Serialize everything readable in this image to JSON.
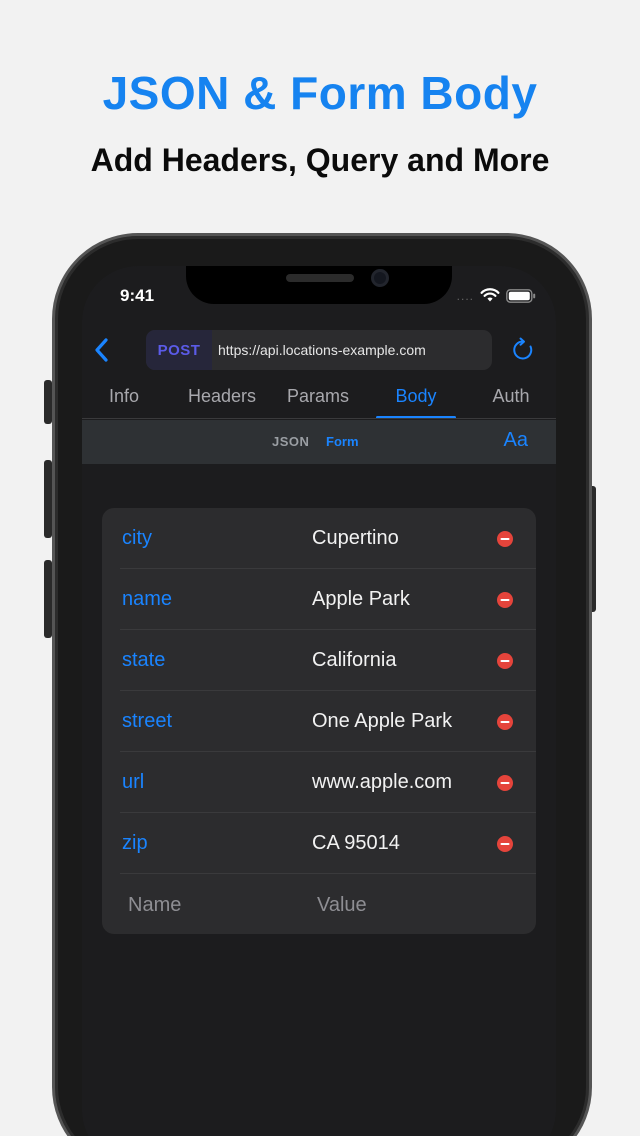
{
  "promo": {
    "headline": "JSON & Form Body",
    "subline": "Add Headers, Query and More"
  },
  "status_bar": {
    "time": "9:41",
    "signal": "....",
    "icons": [
      "wifi-icon",
      "battery-icon"
    ]
  },
  "request": {
    "method": "POST",
    "url": "https://api.locations-example.com",
    "icons": [
      "back-icon",
      "refresh-icon"
    ]
  },
  "tabs": [
    {
      "label": "Info",
      "active": false
    },
    {
      "label": "Headers",
      "active": false
    },
    {
      "label": "Params",
      "active": false
    },
    {
      "label": "Body",
      "active": true
    },
    {
      "label": "Auth",
      "active": false
    }
  ],
  "body_toolbar": {
    "json_label": "JSON",
    "form_label": "Form",
    "selected": "Form",
    "font_button": "Aa"
  },
  "form_fields": [
    {
      "key": "city",
      "value": "Cupertino"
    },
    {
      "key": "name",
      "value": "Apple Park"
    },
    {
      "key": "state",
      "value": "California"
    },
    {
      "key": "street",
      "value": "One Apple Park"
    },
    {
      "key": "url",
      "value": "www.apple.com"
    },
    {
      "key": "zip",
      "value": "CA 95014"
    }
  ],
  "new_field": {
    "name_placeholder": "Name",
    "value_placeholder": "Value"
  },
  "colors": {
    "accent": "#1a84ff",
    "headline": "#1683f0",
    "method": "#5b5be8",
    "remove": "#e5443b",
    "background": "#f2f2f2",
    "screen": "#1c1c1e"
  }
}
